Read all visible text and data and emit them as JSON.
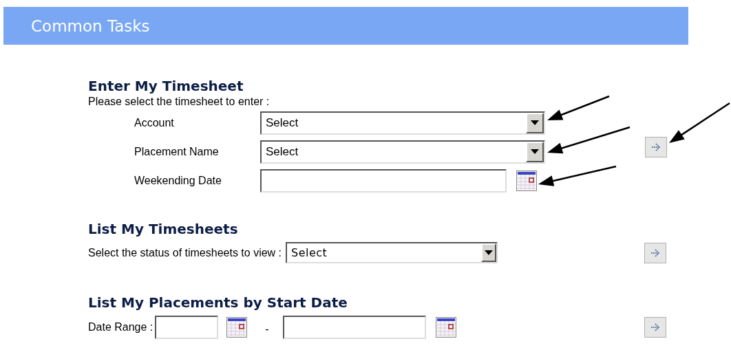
{
  "header": {
    "title": "Common Tasks"
  },
  "enter_timesheet": {
    "heading": "Enter My Timesheet",
    "prompt": "Please select the timesheet to enter :",
    "fields": [
      {
        "label": "Account",
        "kind": "select",
        "value": "Select"
      },
      {
        "label": "Placement Name",
        "kind": "select",
        "value": "Select"
      },
      {
        "label": "Weekending Date",
        "kind": "date"
      }
    ]
  },
  "list_timesheets": {
    "heading": "List My Timesheets",
    "prompt": "Select the status of timesheets to view :",
    "select": {
      "value": "Select"
    }
  },
  "list_placements": {
    "heading": "List My Placements by Start Date",
    "prompt": "Date Range :",
    "separator": "-"
  }
}
